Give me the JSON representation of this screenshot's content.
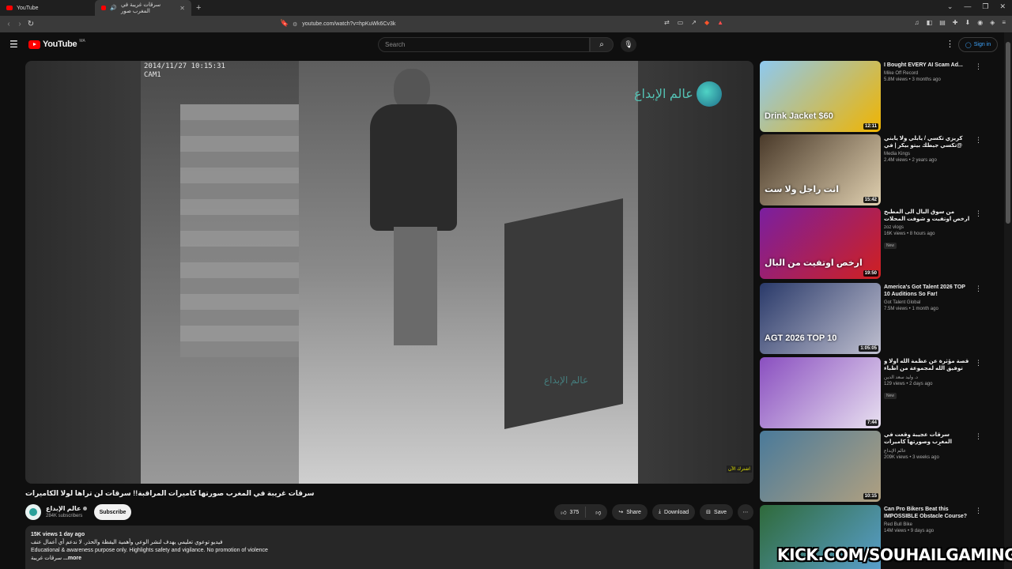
{
  "browser": {
    "tabs": [
      {
        "label": "YouTube"
      },
      {
        "label": "سرقات غريبة في المغرب صور"
      }
    ],
    "url": "youtube.com/watch?v=hpKuWk6Cv3k"
  },
  "masthead": {
    "logo_text": "YouTube",
    "region": "MA",
    "search_placeholder": "Search",
    "signin_label": "Sign in"
  },
  "player": {
    "cam_timestamp": "2014/11/27 10:15:31",
    "cam_label": "CAM1",
    "watermark": "عالم الإبداع",
    "center_watermark": "عالم الإبداع",
    "corner_badge": "اشترك الآن"
  },
  "video": {
    "title": "سرقات غريبة في المغرب صورتها كاميرات المراقبة!! سرقات لن تراها لولا الكاميرات",
    "channel_name": "عالم الإبداع",
    "subscribers": "284K subscribers",
    "subscribe_label": "Subscribe",
    "likes": "375",
    "share_label": "Share",
    "download_label": "Download",
    "save_label": "Save"
  },
  "description": {
    "stats": "15K views  1 day ago",
    "line1": "فيديو توعوي تعليمي يهدف لنشر الوعي وأهمية اليقظة والحذر. لا ندعم أي أعمال عنف",
    "line2": "Educational & awareness purpose only. Highlights safety and vigilance. No promotion of violence",
    "line3": "سرقات غريبة",
    "more": "...more"
  },
  "recommendations": [
    {
      "title": "I Bought EVERY AI Scam Ad...",
      "channel": "Mike Off Record",
      "views": "5.8M views • 3 months ago",
      "duration": "12:11",
      "badge": "",
      "rtl": false,
      "thumb_text": "Drink Jacket $60",
      "colors": [
        "#8ec9f0",
        "#f0b400"
      ]
    },
    {
      "title": "كريزي تكسي / يابلي ولا يابني @تكسي جيطك بيتو بيكر | في سيد كريمي",
      "channel": "Media Kings",
      "views": "2.4M views • 2 years ago",
      "duration": "15:42",
      "badge": "",
      "rtl": true,
      "thumb_text": "انت راجل ولا ست",
      "colors": [
        "#4a3a2a",
        "#e0d0b0"
      ]
    },
    {
      "title": "من سوق البال الى المطبخ ارخص اوتفيت و شوفت المحلات فوق",
      "channel": "zoz vlogs",
      "views": "16K views • 8 hours ago",
      "duration": "19:50",
      "badge": "New",
      "rtl": true,
      "thumb_text": "ارخص اوتفيت من البال",
      "colors": [
        "#7a1fa0",
        "#d02020"
      ]
    },
    {
      "title": "America's Got Talent 2026 TOP 10 Auditions So Far!",
      "channel": "Got Talent Global",
      "views": "7.5M views • 1 month ago",
      "duration": "1:05:05",
      "badge": "",
      "rtl": false,
      "thumb_text": "AGT 2026 TOP 10",
      "colors": [
        "#2a3a6a",
        "#c0c0d0"
      ]
    },
    {
      "title": "قصة مؤثرة عن عظمة الله اولا و توفيق الله لمجموعة من اطباء",
      "channel": "د. وليد سعد الدين",
      "views": "129 views • 2 days ago",
      "duration": "7:44",
      "badge": "New",
      "rtl": true,
      "thumb_text": "",
      "colors": [
        "#8a4fc0",
        "#e8e0f0"
      ]
    },
    {
      "title": "سرقات عجيبة وقعت في المغرب وصورتها كاميرات المراقبة! أغرب سرقات لن ترى",
      "channel": "عالم الإبداع",
      "views": "209K views • 3 weeks ago",
      "duration": "10:15",
      "badge": "",
      "rtl": true,
      "thumb_text": "",
      "colors": [
        "#4a7a9a",
        "#b0a080"
      ]
    },
    {
      "title": "Can Pro Bikers Beat this IMPOSSIBLE Obstacle Course?",
      "channel": "Red Bull Bike",
      "views": "14M views • 9 days ago",
      "duration": "",
      "badge": "",
      "rtl": false,
      "thumb_text": "",
      "colors": [
        "#2f6a3a",
        "#5aa0d0"
      ]
    }
  ],
  "overlay": {
    "kick_text": "KICK.COM/SOUHAILGAMING"
  },
  "colors": {
    "background": "#0f0f0f",
    "accent_red": "#ff0000",
    "link_blue": "#3ea6ff"
  }
}
